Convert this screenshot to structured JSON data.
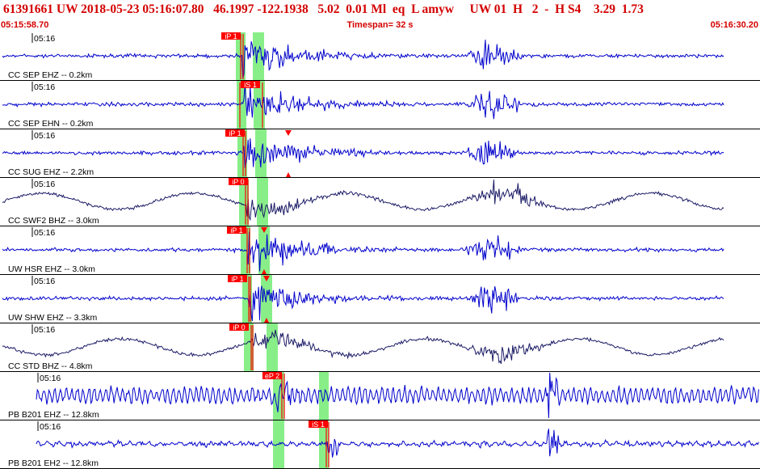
{
  "header": {
    "text": "61391661 UW 2018-05-23 05:16:07.80   46.1997 -122.1938   5.02  0.01 Ml  eq  L amyw     UW 01  H   2  -  H S4    3.29  1.73"
  },
  "timebar": {
    "start": "05:15:58.70",
    "span": "Timespan=  32 s",
    "end": "05:16:30.20"
  },
  "colors": {
    "header_text": "#d40000",
    "trace_blue": "#0000cc",
    "trace_navy": "#1a1a66",
    "pick_band": "#88ee88",
    "pick_red": "#ff0000"
  },
  "traces": [
    {
      "label": "CC SEP EHZ -- 0.2km",
      "time": "05:16",
      "pick": "iP 1",
      "color": "blue",
      "type": "short"
    },
    {
      "label": "CC SEP EHN -- 0.2km",
      "time": "05:16",
      "pick": "iS 1",
      "color": "blue",
      "type": "short"
    },
    {
      "label": "CC SUG EHZ -- 2.2km",
      "time": "05:16",
      "pick": "iP 1",
      "color": "blue",
      "type": "short"
    },
    {
      "label": "CC SWF2 BHZ -- 3.0km",
      "time": "05:16",
      "pick": "iP 0",
      "color": "navy",
      "type": "long"
    },
    {
      "label": "UW HSR EHZ -- 3.0km",
      "time": "05:16",
      "pick": "iP 1",
      "color": "blue",
      "type": "short"
    },
    {
      "label": "UW SHW EHZ -- 3.3km",
      "time": "05:16",
      "pick": "iP 1",
      "color": "blue",
      "type": "short"
    },
    {
      "label": "CC STD BHZ -- 4.8km",
      "time": "05:16",
      "pick": "iP 0",
      "color": "navy",
      "type": "long"
    },
    {
      "label": "PB B201 EHZ -- 12.8km",
      "time": "05:16",
      "pick": "eP 2",
      "color": "blue",
      "type": "noisy"
    },
    {
      "label": "PB B201 EH2 -- 12.8km",
      "time": "05:16",
      "pick": "iS 1",
      "color": "blue",
      "type": "quiet"
    }
  ]
}
